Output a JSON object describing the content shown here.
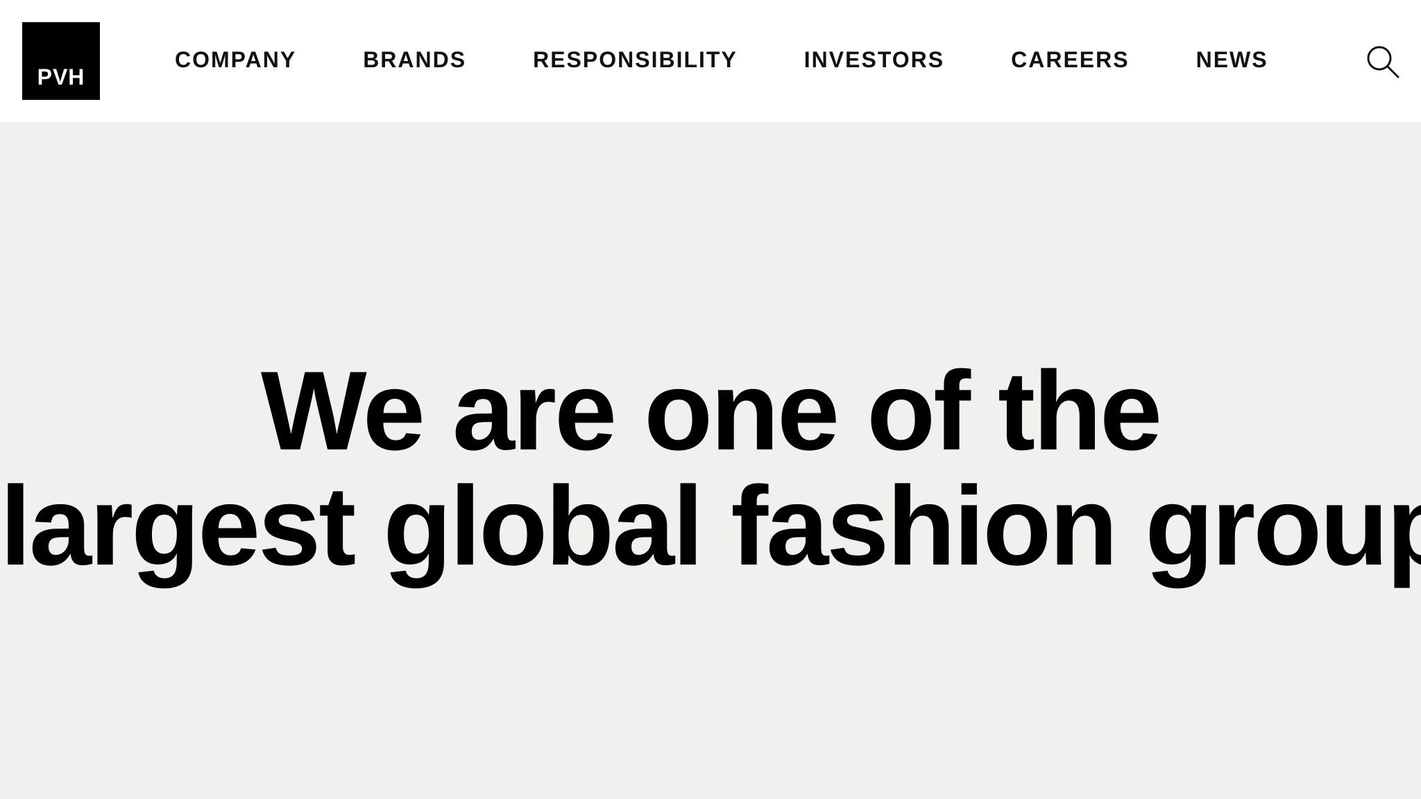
{
  "logo": {
    "text": "PVH"
  },
  "nav": {
    "items": [
      {
        "label": "COMPANY"
      },
      {
        "label": "BRANDS"
      },
      {
        "label": "RESPONSIBILITY"
      },
      {
        "label": "INVESTORS"
      },
      {
        "label": "CAREERS"
      },
      {
        "label": "NEWS"
      }
    ]
  },
  "search": {
    "icon": "search-icon"
  },
  "hero": {
    "line1": "We are one of the",
    "line2": "largest global fashion groups"
  },
  "colors": {
    "logo_background": "#000000",
    "logo_text": "#ffffff",
    "nav_text": "#111111",
    "header_background": "#ffffff",
    "hero_background": "#f0f0ef",
    "hero_text": "#000000"
  }
}
